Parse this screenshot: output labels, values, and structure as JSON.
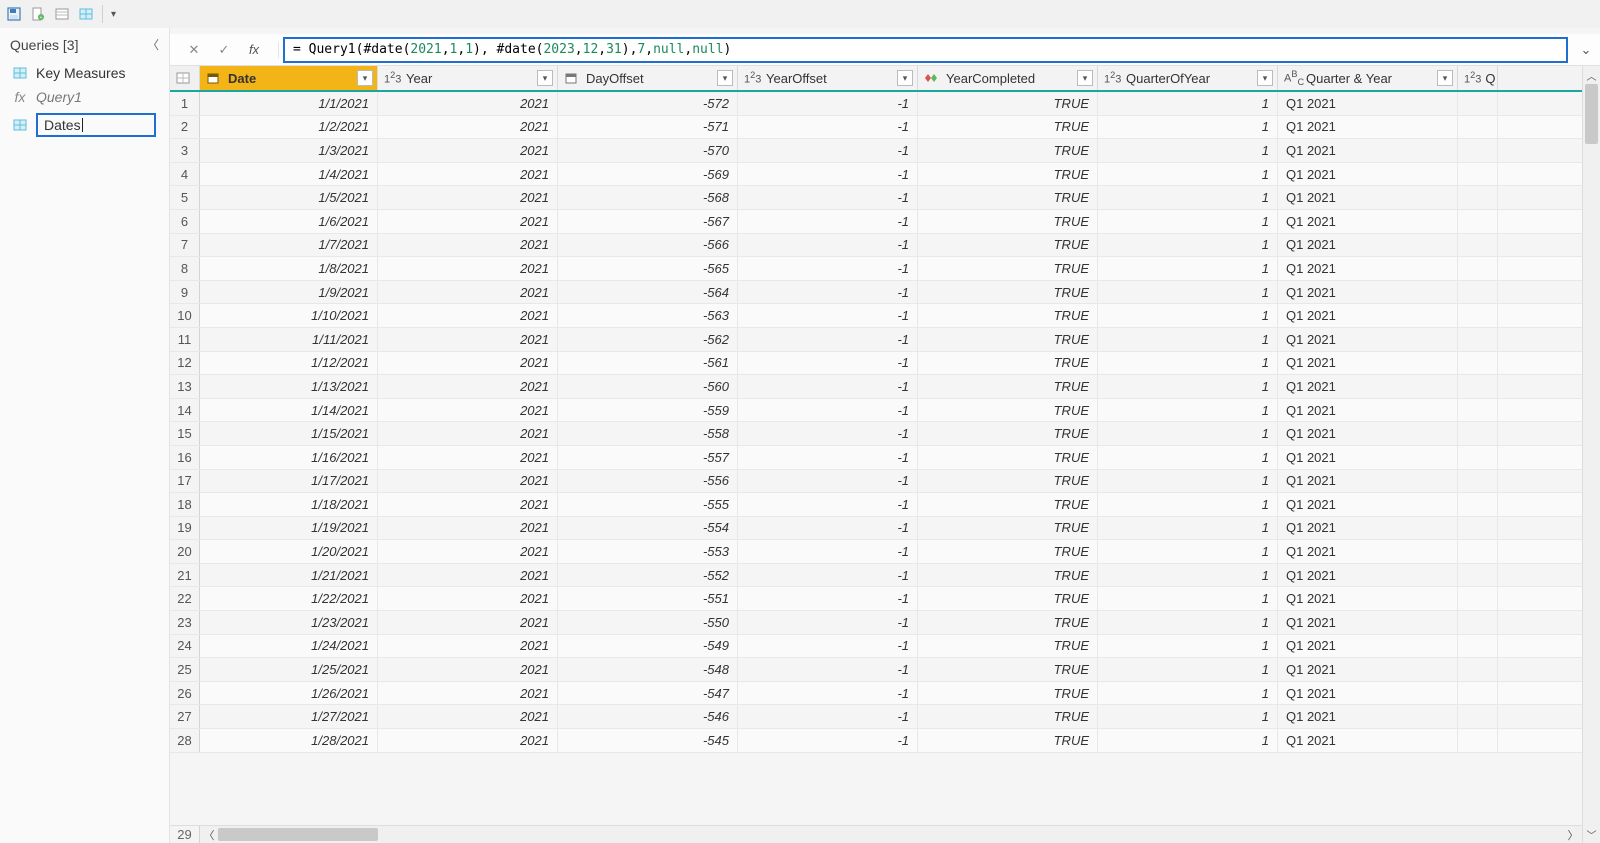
{
  "qat": {
    "dropdown": "▾"
  },
  "sidebar": {
    "title": "Queries [3]",
    "items": [
      {
        "label": "Key Measures",
        "kind": "table"
      },
      {
        "label": "Query1",
        "kind": "function"
      },
      {
        "label": "Dates",
        "kind": "table",
        "editing": true
      }
    ]
  },
  "formula": {
    "prefix": "= ",
    "fn": "Query1",
    "tokens_html": "= Query1(#date(<n>2021</n>, <n>1</n>, <n>1</n>), #date(<n>2023</n>, <n>12</n>, <n>31</n>), <n>7</n>, <k>null</k>, <k>null</k>)"
  },
  "columns": [
    {
      "key": "Date",
      "type": "date"
    },
    {
      "key": "Year",
      "type": "int"
    },
    {
      "key": "DayOffset",
      "type": "date"
    },
    {
      "key": "YearOffset",
      "type": "int"
    },
    {
      "key": "YearCompleted",
      "type": "bool"
    },
    {
      "key": "QuarterOfYear",
      "type": "int"
    },
    {
      "key": "Quarter & Year",
      "type": "text"
    },
    {
      "key": "Q",
      "type": "int",
      "partial": true
    }
  ],
  "rows": [
    {
      "n": 1,
      "Date": "1/1/2021",
      "Year": "2021",
      "DayOffset": "-572",
      "YearOffset": "-1",
      "YearCompleted": "TRUE",
      "QuarterOfYear": "1",
      "QuarterYear": "Q1 2021"
    },
    {
      "n": 2,
      "Date": "1/2/2021",
      "Year": "2021",
      "DayOffset": "-571",
      "YearOffset": "-1",
      "YearCompleted": "TRUE",
      "QuarterOfYear": "1",
      "QuarterYear": "Q1 2021"
    },
    {
      "n": 3,
      "Date": "1/3/2021",
      "Year": "2021",
      "DayOffset": "-570",
      "YearOffset": "-1",
      "YearCompleted": "TRUE",
      "QuarterOfYear": "1",
      "QuarterYear": "Q1 2021"
    },
    {
      "n": 4,
      "Date": "1/4/2021",
      "Year": "2021",
      "DayOffset": "-569",
      "YearOffset": "-1",
      "YearCompleted": "TRUE",
      "QuarterOfYear": "1",
      "QuarterYear": "Q1 2021"
    },
    {
      "n": 5,
      "Date": "1/5/2021",
      "Year": "2021",
      "DayOffset": "-568",
      "YearOffset": "-1",
      "YearCompleted": "TRUE",
      "QuarterOfYear": "1",
      "QuarterYear": "Q1 2021"
    },
    {
      "n": 6,
      "Date": "1/6/2021",
      "Year": "2021",
      "DayOffset": "-567",
      "YearOffset": "-1",
      "YearCompleted": "TRUE",
      "QuarterOfYear": "1",
      "QuarterYear": "Q1 2021"
    },
    {
      "n": 7,
      "Date": "1/7/2021",
      "Year": "2021",
      "DayOffset": "-566",
      "YearOffset": "-1",
      "YearCompleted": "TRUE",
      "QuarterOfYear": "1",
      "QuarterYear": "Q1 2021"
    },
    {
      "n": 8,
      "Date": "1/8/2021",
      "Year": "2021",
      "DayOffset": "-565",
      "YearOffset": "-1",
      "YearCompleted": "TRUE",
      "QuarterOfYear": "1",
      "QuarterYear": "Q1 2021"
    },
    {
      "n": 9,
      "Date": "1/9/2021",
      "Year": "2021",
      "DayOffset": "-564",
      "YearOffset": "-1",
      "YearCompleted": "TRUE",
      "QuarterOfYear": "1",
      "QuarterYear": "Q1 2021"
    },
    {
      "n": 10,
      "Date": "1/10/2021",
      "Year": "2021",
      "DayOffset": "-563",
      "YearOffset": "-1",
      "YearCompleted": "TRUE",
      "QuarterOfYear": "1",
      "QuarterYear": "Q1 2021"
    },
    {
      "n": 11,
      "Date": "1/11/2021",
      "Year": "2021",
      "DayOffset": "-562",
      "YearOffset": "-1",
      "YearCompleted": "TRUE",
      "QuarterOfYear": "1",
      "QuarterYear": "Q1 2021"
    },
    {
      "n": 12,
      "Date": "1/12/2021",
      "Year": "2021",
      "DayOffset": "-561",
      "YearOffset": "-1",
      "YearCompleted": "TRUE",
      "QuarterOfYear": "1",
      "QuarterYear": "Q1 2021"
    },
    {
      "n": 13,
      "Date": "1/13/2021",
      "Year": "2021",
      "DayOffset": "-560",
      "YearOffset": "-1",
      "YearCompleted": "TRUE",
      "QuarterOfYear": "1",
      "QuarterYear": "Q1 2021"
    },
    {
      "n": 14,
      "Date": "1/14/2021",
      "Year": "2021",
      "DayOffset": "-559",
      "YearOffset": "-1",
      "YearCompleted": "TRUE",
      "QuarterOfYear": "1",
      "QuarterYear": "Q1 2021"
    },
    {
      "n": 15,
      "Date": "1/15/2021",
      "Year": "2021",
      "DayOffset": "-558",
      "YearOffset": "-1",
      "YearCompleted": "TRUE",
      "QuarterOfYear": "1",
      "QuarterYear": "Q1 2021"
    },
    {
      "n": 16,
      "Date": "1/16/2021",
      "Year": "2021",
      "DayOffset": "-557",
      "YearOffset": "-1",
      "YearCompleted": "TRUE",
      "QuarterOfYear": "1",
      "QuarterYear": "Q1 2021"
    },
    {
      "n": 17,
      "Date": "1/17/2021",
      "Year": "2021",
      "DayOffset": "-556",
      "YearOffset": "-1",
      "YearCompleted": "TRUE",
      "QuarterOfYear": "1",
      "QuarterYear": "Q1 2021"
    },
    {
      "n": 18,
      "Date": "1/18/2021",
      "Year": "2021",
      "DayOffset": "-555",
      "YearOffset": "-1",
      "YearCompleted": "TRUE",
      "QuarterOfYear": "1",
      "QuarterYear": "Q1 2021"
    },
    {
      "n": 19,
      "Date": "1/19/2021",
      "Year": "2021",
      "DayOffset": "-554",
      "YearOffset": "-1",
      "YearCompleted": "TRUE",
      "QuarterOfYear": "1",
      "QuarterYear": "Q1 2021"
    },
    {
      "n": 20,
      "Date": "1/20/2021",
      "Year": "2021",
      "DayOffset": "-553",
      "YearOffset": "-1",
      "YearCompleted": "TRUE",
      "QuarterOfYear": "1",
      "QuarterYear": "Q1 2021"
    },
    {
      "n": 21,
      "Date": "1/21/2021",
      "Year": "2021",
      "DayOffset": "-552",
      "YearOffset": "-1",
      "YearCompleted": "TRUE",
      "QuarterOfYear": "1",
      "QuarterYear": "Q1 2021"
    },
    {
      "n": 22,
      "Date": "1/22/2021",
      "Year": "2021",
      "DayOffset": "-551",
      "YearOffset": "-1",
      "YearCompleted": "TRUE",
      "QuarterOfYear": "1",
      "QuarterYear": "Q1 2021"
    },
    {
      "n": 23,
      "Date": "1/23/2021",
      "Year": "2021",
      "DayOffset": "-550",
      "YearOffset": "-1",
      "YearCompleted": "TRUE",
      "QuarterOfYear": "1",
      "QuarterYear": "Q1 2021"
    },
    {
      "n": 24,
      "Date": "1/24/2021",
      "Year": "2021",
      "DayOffset": "-549",
      "YearOffset": "-1",
      "YearCompleted": "TRUE",
      "QuarterOfYear": "1",
      "QuarterYear": "Q1 2021"
    },
    {
      "n": 25,
      "Date": "1/25/2021",
      "Year": "2021",
      "DayOffset": "-548",
      "YearOffset": "-1",
      "YearCompleted": "TRUE",
      "QuarterOfYear": "1",
      "QuarterYear": "Q1 2021"
    },
    {
      "n": 26,
      "Date": "1/26/2021",
      "Year": "2021",
      "DayOffset": "-547",
      "YearOffset": "-1",
      "YearCompleted": "TRUE",
      "QuarterOfYear": "1",
      "QuarterYear": "Q1 2021"
    },
    {
      "n": 27,
      "Date": "1/27/2021",
      "Year": "2021",
      "DayOffset": "-546",
      "YearOffset": "-1",
      "YearCompleted": "TRUE",
      "QuarterOfYear": "1",
      "QuarterYear": "Q1 2021"
    },
    {
      "n": 28,
      "Date": "1/28/2021",
      "Year": "2021",
      "DayOffset": "-545",
      "YearOffset": "-1",
      "YearCompleted": "TRUE",
      "QuarterOfYear": "1",
      "QuarterYear": "Q1 2021"
    }
  ],
  "last_row_stub": "29"
}
